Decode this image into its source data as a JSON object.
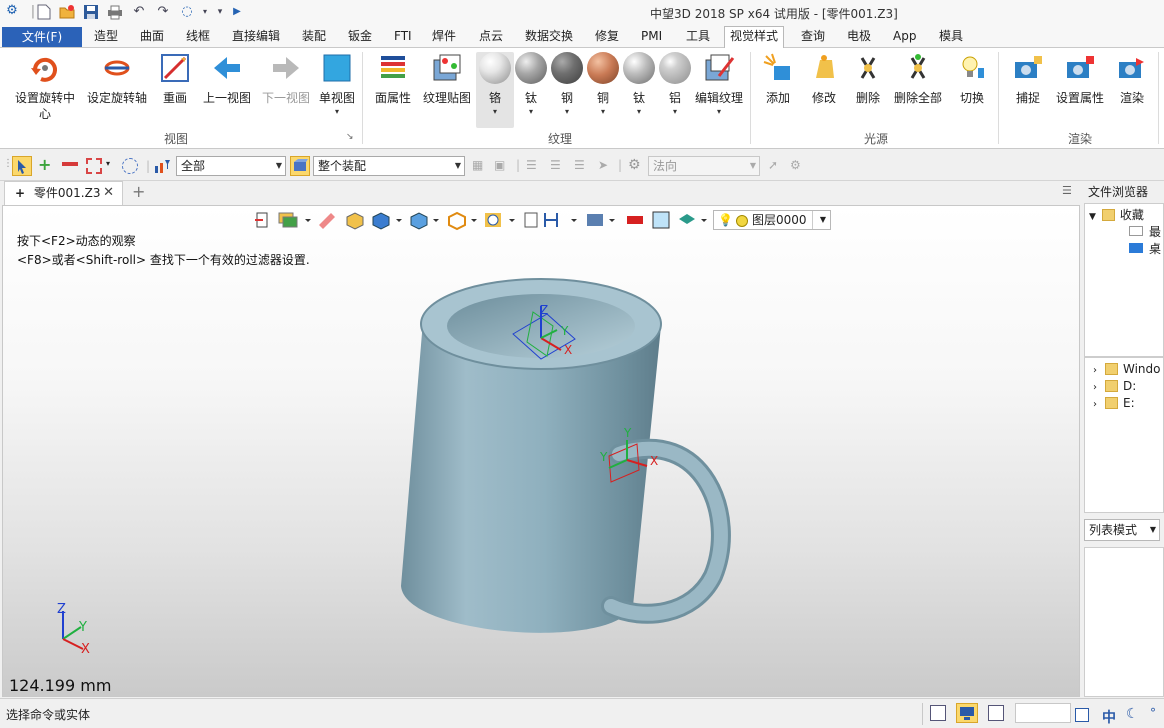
{
  "titlebar": {
    "title": "中望3D 2018 SP x64 试用版 - [零件001.Z3]"
  },
  "menu": {
    "file": "文件(F)",
    "items": [
      "造型",
      "曲面",
      "线框",
      "直接编辑",
      "装配",
      "钣金",
      "FTI",
      "焊件",
      "点云",
      "数据交换",
      "修复",
      "PMI",
      "工具",
      "视觉样式",
      "查询",
      "电极",
      "App",
      "模具"
    ]
  },
  "ribbon": {
    "view": {
      "group_label": "视图",
      "set_rot_center_line1": "设置旋转中",
      "set_rot_center_line2": "心",
      "set_rot_axis": "设定旋转轴",
      "redraw": "重画",
      "prev_view": "上一视图",
      "next_view": "下一视图",
      "single_view": "单视图"
    },
    "texture": {
      "group_label": "纹理",
      "face_attr": "面属性",
      "texture_map": "纹理贴图",
      "chrome": "铬",
      "titanium": "钛",
      "steel": "钢",
      "copper": "铜",
      "titanium2": "钛",
      "aluminum": "铝",
      "edit_texture": "编辑纹理"
    },
    "light": {
      "group_label": "光源",
      "add": "添加",
      "modify": "修改",
      "delete": "删除",
      "delete_all": "删除全部",
      "toggle": "切换"
    },
    "render": {
      "group_label": "渲染",
      "capture": "捕捉",
      "set_attr": "设置属性",
      "render": "渲染"
    }
  },
  "toolbar2": {
    "filter_value": "全部",
    "assembly_value": "整个装配",
    "normal_placeholder": "法向"
  },
  "document": {
    "tab_label": "零件001.Z3",
    "layer_label": "图层0000",
    "hint_line1": "按下<F2>动态的观察",
    "hint_line2": "<F8>或者<Shift-roll> 查找下一个有效的过滤器设置.",
    "distance": "124.199 mm",
    "axis_x": "X",
    "axis_y": "Y",
    "axis_z": "Z"
  },
  "file_browser": {
    "title": "文件浏览器",
    "favorites": "收藏",
    "fav_child1": "最",
    "fav_child2": "桌",
    "drive1": "Windo",
    "drive2": "D:",
    "drive3": "E:",
    "list_mode": "列表模式"
  },
  "status": {
    "text": "选择命令或实体",
    "ime": "中"
  },
  "colors": {
    "accent": "#2b62b8",
    "mug": "#8fb0be"
  }
}
